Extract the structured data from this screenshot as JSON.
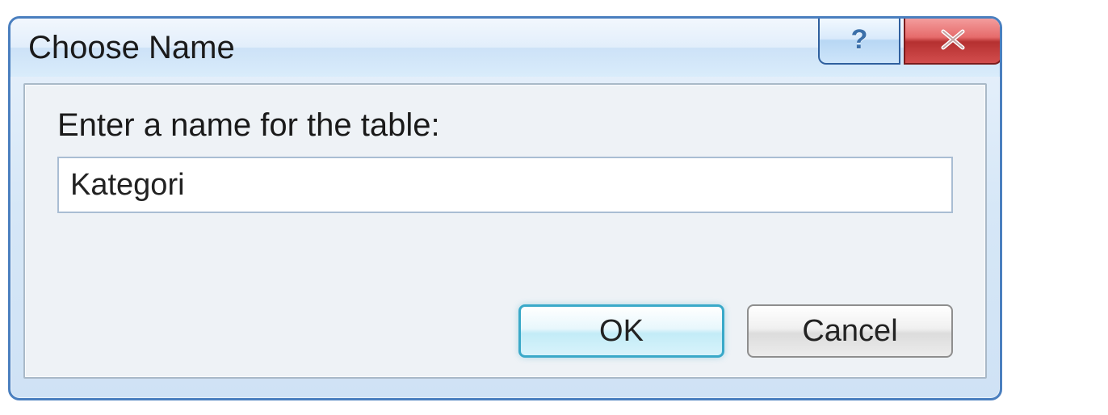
{
  "dialog": {
    "title": "Choose Name",
    "prompt": "Enter a name for the table:",
    "input_value": "Kategori",
    "buttons": {
      "ok": "OK",
      "cancel": "Cancel"
    }
  }
}
